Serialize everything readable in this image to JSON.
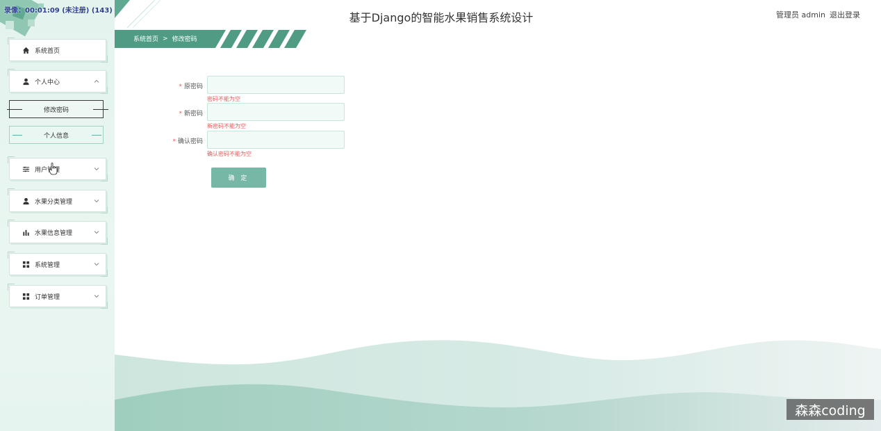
{
  "overlay": {
    "timer_text": "录像：00:01:09 (未注册) (143)"
  },
  "header": {
    "title": "基于Django的智能水果销售系统设计",
    "user_label": "管理员 admin",
    "logout_label": "退出登录"
  },
  "breadcrumb": {
    "home": "系统首页",
    "separator": ">",
    "current": "修改密码"
  },
  "sidebar": {
    "items": [
      {
        "label": "系统首页",
        "icon": "home-icon",
        "has_chevron": false
      },
      {
        "label": "个人中心",
        "icon": "user-icon",
        "has_chevron": true,
        "expanded": true
      },
      {
        "label": "用户管理",
        "icon": "sliders-icon",
        "has_chevron": true
      },
      {
        "label": "水果分类管理",
        "icon": "user-icon",
        "has_chevron": true
      },
      {
        "label": "水果信息管理",
        "icon": "bar-chart-icon",
        "has_chevron": true
      },
      {
        "label": "系统管理",
        "icon": "grid-icon",
        "has_chevron": true
      },
      {
        "label": "订单管理",
        "icon": "grid-icon",
        "has_chevron": true
      }
    ],
    "subitems": [
      {
        "label": "修改密码",
        "active": true
      },
      {
        "label": "个人信息",
        "active": false
      }
    ]
  },
  "form": {
    "fields": [
      {
        "label": "原密码",
        "required": true,
        "value": "",
        "error": "密码不能为空"
      },
      {
        "label": "新密码",
        "required": true,
        "value": "",
        "error": "新密码不能为空"
      },
      {
        "label": "确认密码",
        "required": true,
        "value": "",
        "error": "确认密码不能为空"
      }
    ],
    "submit_label": "确 定"
  },
  "watermark": "森森coding",
  "colors": {
    "accent": "#4f9b84",
    "accent_light": "#76b8a5",
    "error": "#e55a5a",
    "sidebar_bg": "#e6f4ef"
  }
}
